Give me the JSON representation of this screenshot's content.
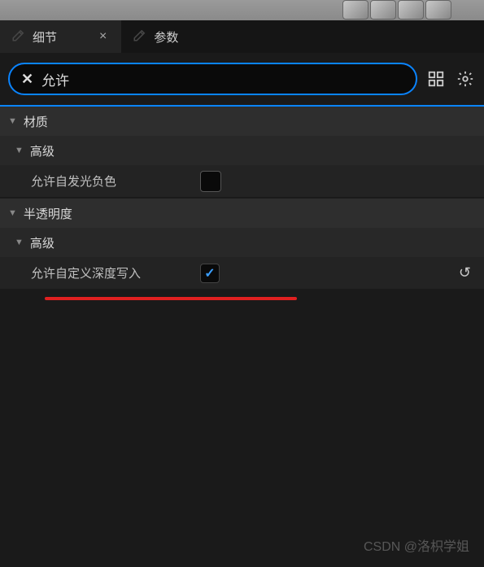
{
  "tabs": {
    "details": {
      "label": "细节"
    },
    "params": {
      "label": "参数"
    }
  },
  "search": {
    "value": "允许",
    "clear": "✕"
  },
  "sections": {
    "material": {
      "label": "材质"
    },
    "advanced1": {
      "label": "高级"
    },
    "emissiveNegative": {
      "label": "允许自发光负色"
    },
    "translucency": {
      "label": "半透明度"
    },
    "advanced2": {
      "label": "高级"
    },
    "customDepthWrite": {
      "label": "允许自定义深度写入",
      "checked": "✓"
    }
  },
  "watermark": "CSDN @洛枳学姐"
}
